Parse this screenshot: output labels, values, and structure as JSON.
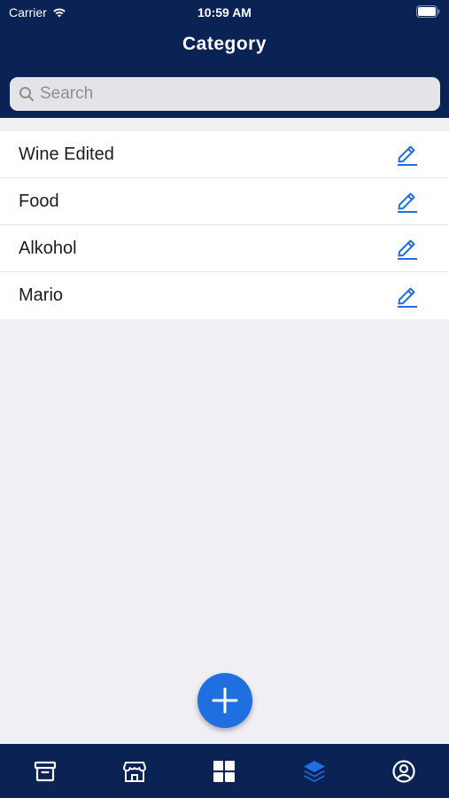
{
  "status_bar": {
    "carrier": "Carrier",
    "time": "10:59 AM"
  },
  "header": {
    "title": "Category"
  },
  "search": {
    "placeholder": "Search",
    "value": ""
  },
  "categories": [
    {
      "label": "Wine Edited",
      "action_icon": "pencil-icon"
    },
    {
      "label": "Food",
      "action_icon": "pencil-icon"
    },
    {
      "label": "Alkohol",
      "action_icon": "pencil-icon"
    },
    {
      "label": "Mario",
      "action_icon": "pencil-icon"
    }
  ],
  "fab": {
    "icon": "plus-icon"
  },
  "tab_bar": {
    "tabs": [
      {
        "icon": "archive-box-icon",
        "active": false
      },
      {
        "icon": "storefront-icon",
        "active": false
      },
      {
        "icon": "grid-icon",
        "active": false
      },
      {
        "icon": "layers-icon",
        "active": true
      },
      {
        "icon": "user-circle-icon",
        "active": false
      }
    ]
  },
  "colors": {
    "header_bg": "#0b2254",
    "accent": "#1f6fe0",
    "page_bg": "#efeff4"
  }
}
